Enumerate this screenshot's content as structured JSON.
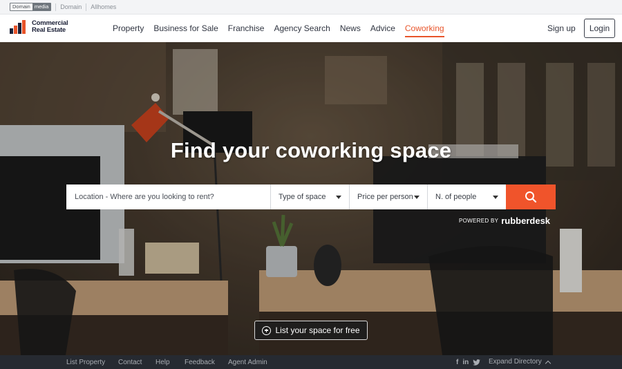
{
  "network_bar": {
    "domain_logo_left": "Domain",
    "domain_logo_right": "media",
    "links": [
      "Domain",
      "Allhomes"
    ]
  },
  "header": {
    "brand_line1": "Commercial",
    "brand_line2": "Real Estate",
    "nav": [
      "Property",
      "Business for Sale",
      "Franchise",
      "Agency Search",
      "News",
      "Advice",
      "Coworking"
    ],
    "active_nav": "Coworking",
    "signup": "Sign up",
    "login": "Login"
  },
  "hero": {
    "title": "Find your coworking space",
    "search": {
      "location_placeholder": "Location - Where are you looking to rent?",
      "type_of_space": "Type of space",
      "price_per_person": "Price per person",
      "num_people": "N. of people"
    },
    "powered_by": "POWERED BY",
    "powered_brand": "rubberdesk",
    "list_space": "List your space for free"
  },
  "footer": {
    "links": [
      "List Property",
      "Contact",
      "Help",
      "Feedback",
      "Agent Admin"
    ],
    "social": [
      "f",
      "in",
      "twitter"
    ],
    "expand": "Expand Directory"
  },
  "colors": {
    "accent": "#f0542b",
    "footer_bg": "#262a31"
  }
}
